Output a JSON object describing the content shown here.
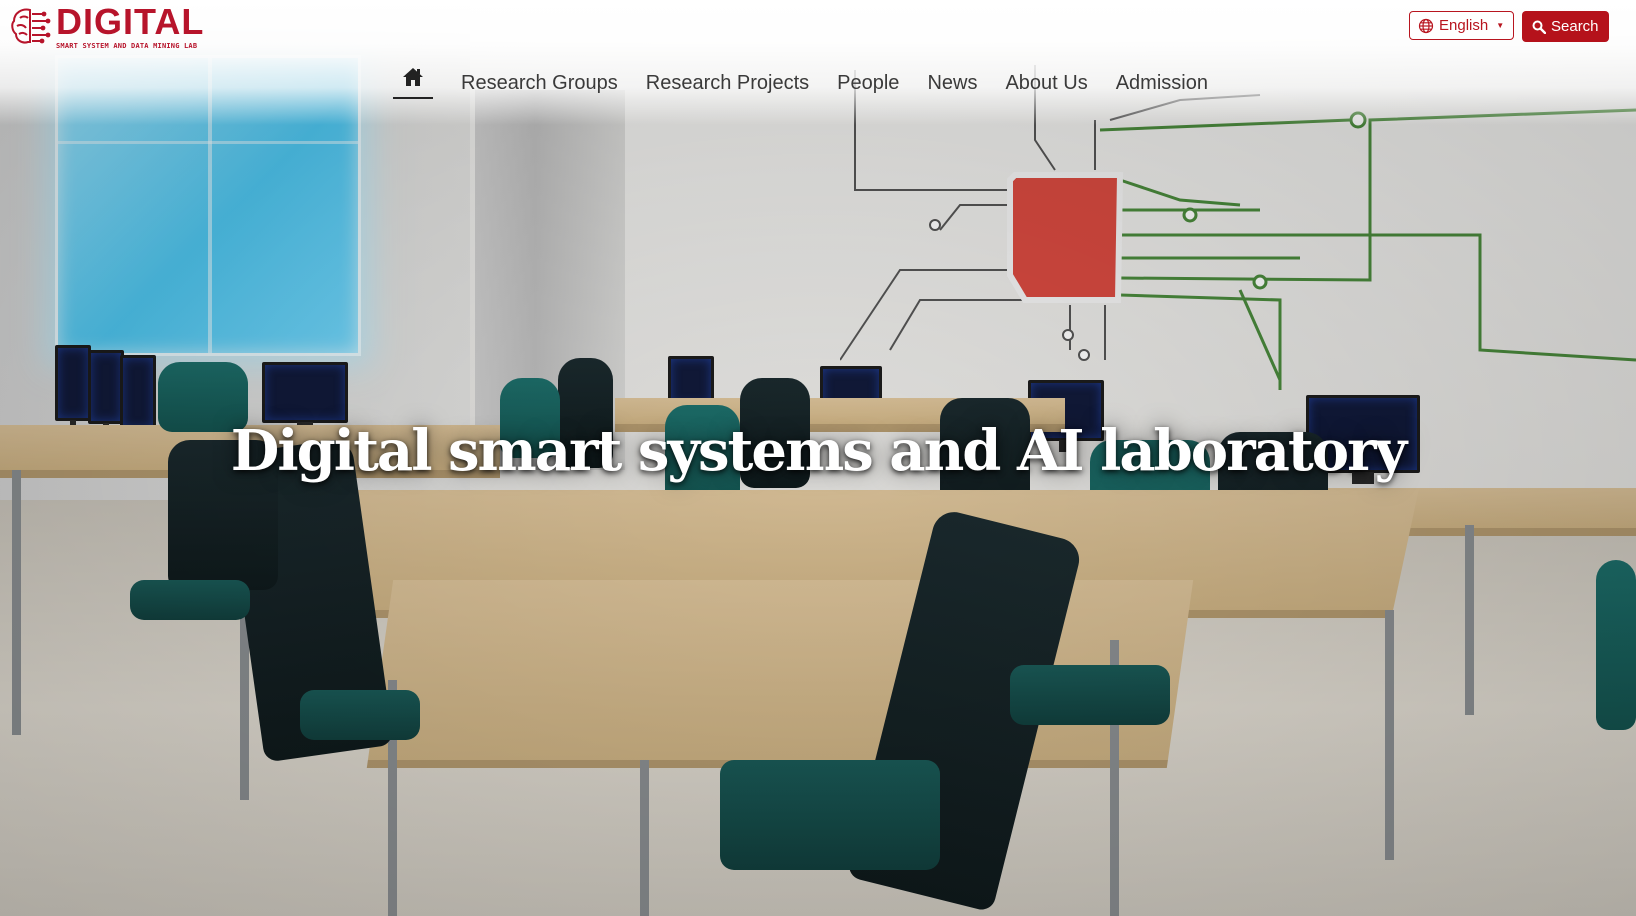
{
  "brand": {
    "title": "DIGITAL",
    "subtitle": "SMART SYSTEM AND DATA MINING LAB",
    "color": "#b7142b",
    "icon": "brain-circuit-icon"
  },
  "header": {
    "language_label": "English",
    "language_icon": "globe-icon",
    "search_label": "Search",
    "search_icon": "search-icon"
  },
  "nav": {
    "home_icon": "home-icon",
    "items": [
      {
        "label": "Research Groups"
      },
      {
        "label": "Research Projects"
      },
      {
        "label": "People"
      },
      {
        "label": "News"
      },
      {
        "label": "About Us"
      },
      {
        "label": "Admission"
      }
    ]
  },
  "hero": {
    "title": "Digital smart systems and AI laboratory"
  },
  "colors": {
    "accent": "#b5121b"
  }
}
